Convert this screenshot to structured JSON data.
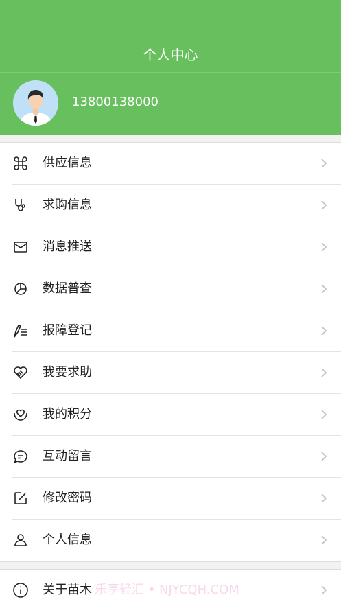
{
  "header": {
    "title": "个人中心",
    "phone": "13800138000",
    "background": "#67bf5d"
  },
  "menu": [
    {
      "label": "供应信息",
      "icon": "command-icon"
    },
    {
      "label": "求购信息",
      "icon": "stethoscope-icon"
    },
    {
      "label": "消息推送",
      "icon": "mail-icon"
    },
    {
      "label": "数据普查",
      "icon": "pie-chart-icon"
    },
    {
      "label": "报障登记",
      "icon": "pen-list-icon"
    },
    {
      "label": "我要求助",
      "icon": "handshake-heart-icon"
    },
    {
      "label": "我的积分",
      "icon": "heart-hands-icon"
    },
    {
      "label": "互动留言",
      "icon": "chat-bubble-icon"
    },
    {
      "label": "修改密码",
      "icon": "edit-square-icon"
    },
    {
      "label": "个人信息",
      "icon": "user-icon"
    }
  ],
  "about": {
    "label": "关于苗木",
    "icon": "info-icon"
  },
  "watermark": "乐享轻汇 • NJYCQH.COM"
}
